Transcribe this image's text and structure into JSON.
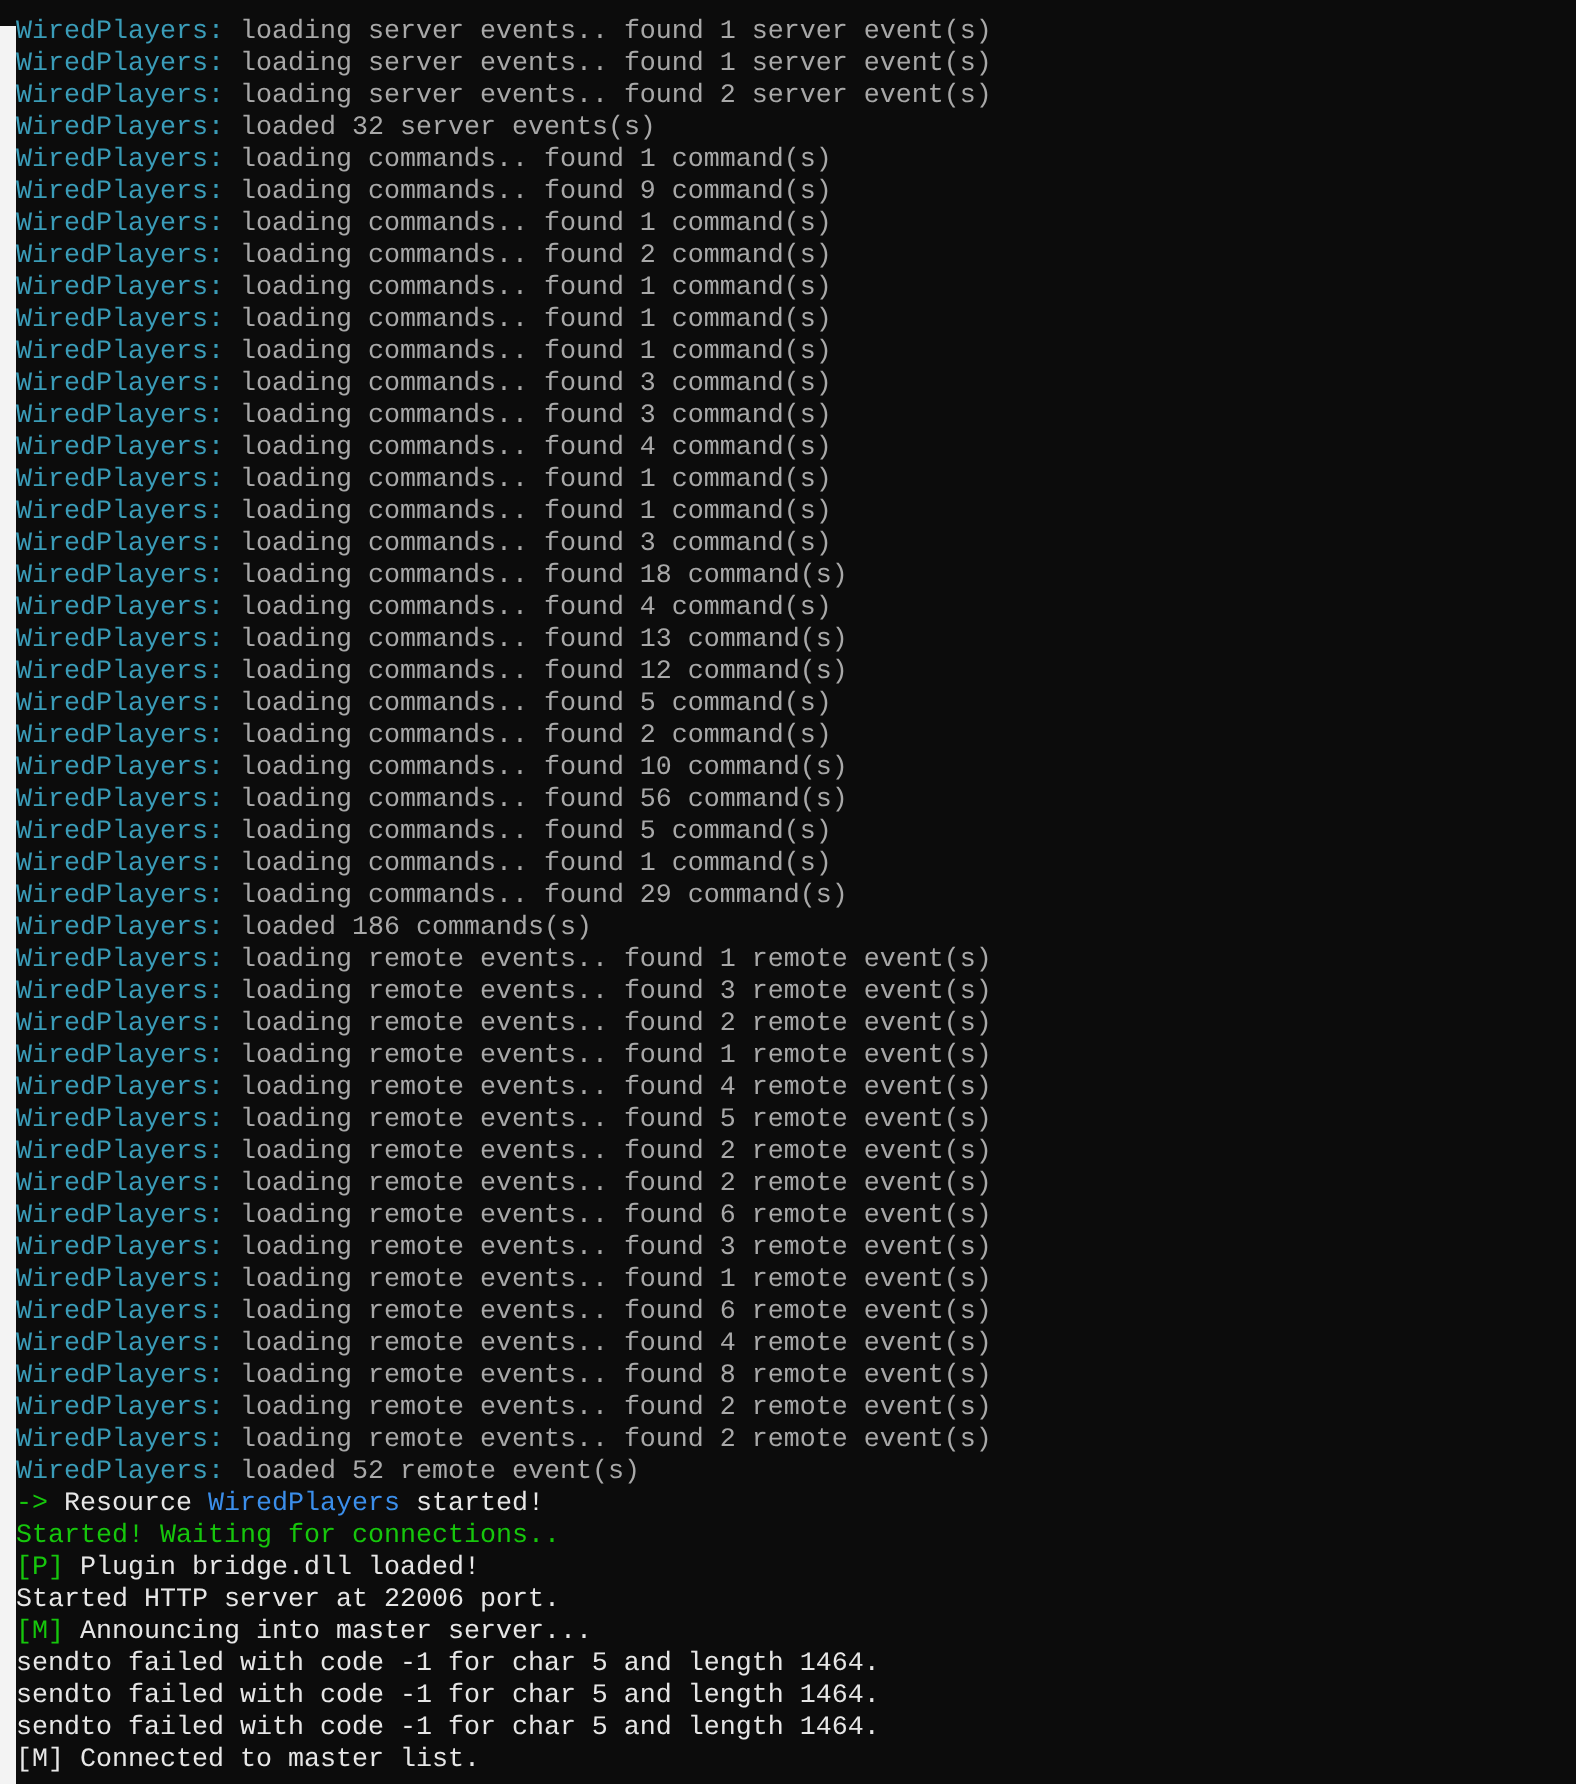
{
  "console": {
    "lines": [
      [
        {
          "text": "WiredPlayers:",
          "kind": "prefix"
        },
        {
          "text": " loading server events.. found 1 server event(s)",
          "kind": "plain"
        }
      ],
      [
        {
          "text": "WiredPlayers:",
          "kind": "prefix"
        },
        {
          "text": " loading server events.. found 1 server event(s)",
          "kind": "plain"
        }
      ],
      [
        {
          "text": "WiredPlayers:",
          "kind": "prefix"
        },
        {
          "text": " loading server events.. found 2 server event(s)",
          "kind": "plain"
        }
      ],
      [
        {
          "text": "WiredPlayers:",
          "kind": "prefix"
        },
        {
          "text": " loaded 32 server events(s)",
          "kind": "plain"
        }
      ],
      [
        {
          "text": "WiredPlayers:",
          "kind": "prefix"
        },
        {
          "text": " loading commands.. found 1 command(s)",
          "kind": "plain"
        }
      ],
      [
        {
          "text": "WiredPlayers:",
          "kind": "prefix"
        },
        {
          "text": " loading commands.. found 9 command(s)",
          "kind": "plain"
        }
      ],
      [
        {
          "text": "WiredPlayers:",
          "kind": "prefix"
        },
        {
          "text": " loading commands.. found 1 command(s)",
          "kind": "plain"
        }
      ],
      [
        {
          "text": "WiredPlayers:",
          "kind": "prefix"
        },
        {
          "text": " loading commands.. found 2 command(s)",
          "kind": "plain"
        }
      ],
      [
        {
          "text": "WiredPlayers:",
          "kind": "prefix"
        },
        {
          "text": " loading commands.. found 1 command(s)",
          "kind": "plain"
        }
      ],
      [
        {
          "text": "WiredPlayers:",
          "kind": "prefix"
        },
        {
          "text": " loading commands.. found 1 command(s)",
          "kind": "plain"
        }
      ],
      [
        {
          "text": "WiredPlayers:",
          "kind": "prefix"
        },
        {
          "text": " loading commands.. found 1 command(s)",
          "kind": "plain"
        }
      ],
      [
        {
          "text": "WiredPlayers:",
          "kind": "prefix"
        },
        {
          "text": " loading commands.. found 3 command(s)",
          "kind": "plain"
        }
      ],
      [
        {
          "text": "WiredPlayers:",
          "kind": "prefix"
        },
        {
          "text": " loading commands.. found 3 command(s)",
          "kind": "plain"
        }
      ],
      [
        {
          "text": "WiredPlayers:",
          "kind": "prefix"
        },
        {
          "text": " loading commands.. found 4 command(s)",
          "kind": "plain"
        }
      ],
      [
        {
          "text": "WiredPlayers:",
          "kind": "prefix"
        },
        {
          "text": " loading commands.. found 1 command(s)",
          "kind": "plain"
        }
      ],
      [
        {
          "text": "WiredPlayers:",
          "kind": "prefix"
        },
        {
          "text": " loading commands.. found 1 command(s)",
          "kind": "plain"
        }
      ],
      [
        {
          "text": "WiredPlayers:",
          "kind": "prefix"
        },
        {
          "text": " loading commands.. found 3 command(s)",
          "kind": "plain"
        }
      ],
      [
        {
          "text": "WiredPlayers:",
          "kind": "prefix"
        },
        {
          "text": " loading commands.. found 18 command(s)",
          "kind": "plain"
        }
      ],
      [
        {
          "text": "WiredPlayers:",
          "kind": "prefix"
        },
        {
          "text": " loading commands.. found 4 command(s)",
          "kind": "plain"
        }
      ],
      [
        {
          "text": "WiredPlayers:",
          "kind": "prefix"
        },
        {
          "text": " loading commands.. found 13 command(s)",
          "kind": "plain"
        }
      ],
      [
        {
          "text": "WiredPlayers:",
          "kind": "prefix"
        },
        {
          "text": " loading commands.. found 12 command(s)",
          "kind": "plain"
        }
      ],
      [
        {
          "text": "WiredPlayers:",
          "kind": "prefix"
        },
        {
          "text": " loading commands.. found 5 command(s)",
          "kind": "plain"
        }
      ],
      [
        {
          "text": "WiredPlayers:",
          "kind": "prefix"
        },
        {
          "text": " loading commands.. found 2 command(s)",
          "kind": "plain"
        }
      ],
      [
        {
          "text": "WiredPlayers:",
          "kind": "prefix"
        },
        {
          "text": " loading commands.. found 10 command(s)",
          "kind": "plain"
        }
      ],
      [
        {
          "text": "WiredPlayers:",
          "kind": "prefix"
        },
        {
          "text": " loading commands.. found 56 command(s)",
          "kind": "plain"
        }
      ],
      [
        {
          "text": "WiredPlayers:",
          "kind": "prefix"
        },
        {
          "text": " loading commands.. found 5 command(s)",
          "kind": "plain"
        }
      ],
      [
        {
          "text": "WiredPlayers:",
          "kind": "prefix"
        },
        {
          "text": " loading commands.. found 1 command(s)",
          "kind": "plain"
        }
      ],
      [
        {
          "text": "WiredPlayers:",
          "kind": "prefix"
        },
        {
          "text": " loading commands.. found 29 command(s)",
          "kind": "plain"
        }
      ],
      [
        {
          "text": "WiredPlayers:",
          "kind": "prefix"
        },
        {
          "text": " loaded 186 commands(s)",
          "kind": "plain"
        }
      ],
      [
        {
          "text": "WiredPlayers:",
          "kind": "prefix"
        },
        {
          "text": " loading remote events.. found 1 remote event(s)",
          "kind": "plain"
        }
      ],
      [
        {
          "text": "WiredPlayers:",
          "kind": "prefix"
        },
        {
          "text": " loading remote events.. found 3 remote event(s)",
          "kind": "plain"
        }
      ],
      [
        {
          "text": "WiredPlayers:",
          "kind": "prefix"
        },
        {
          "text": " loading remote events.. found 2 remote event(s)",
          "kind": "plain"
        }
      ],
      [
        {
          "text": "WiredPlayers:",
          "kind": "prefix"
        },
        {
          "text": " loading remote events.. found 1 remote event(s)",
          "kind": "plain"
        }
      ],
      [
        {
          "text": "WiredPlayers:",
          "kind": "prefix"
        },
        {
          "text": " loading remote events.. found 4 remote event(s)",
          "kind": "plain"
        }
      ],
      [
        {
          "text": "WiredPlayers:",
          "kind": "prefix"
        },
        {
          "text": " loading remote events.. found 5 remote event(s)",
          "kind": "plain"
        }
      ],
      [
        {
          "text": "WiredPlayers:",
          "kind": "prefix"
        },
        {
          "text": " loading remote events.. found 2 remote event(s)",
          "kind": "plain"
        }
      ],
      [
        {
          "text": "WiredPlayers:",
          "kind": "prefix"
        },
        {
          "text": " loading remote events.. found 2 remote event(s)",
          "kind": "plain"
        }
      ],
      [
        {
          "text": "WiredPlayers:",
          "kind": "prefix"
        },
        {
          "text": " loading remote events.. found 6 remote event(s)",
          "kind": "plain"
        }
      ],
      [
        {
          "text": "WiredPlayers:",
          "kind": "prefix"
        },
        {
          "text": " loading remote events.. found 3 remote event(s)",
          "kind": "plain"
        }
      ],
      [
        {
          "text": "WiredPlayers:",
          "kind": "prefix"
        },
        {
          "text": " loading remote events.. found 1 remote event(s)",
          "kind": "plain"
        }
      ],
      [
        {
          "text": "WiredPlayers:",
          "kind": "prefix"
        },
        {
          "text": " loading remote events.. found 6 remote event(s)",
          "kind": "plain"
        }
      ],
      [
        {
          "text": "WiredPlayers:",
          "kind": "prefix"
        },
        {
          "text": " loading remote events.. found 4 remote event(s)",
          "kind": "plain"
        }
      ],
      [
        {
          "text": "WiredPlayers:",
          "kind": "prefix"
        },
        {
          "text": " loading remote events.. found 8 remote event(s)",
          "kind": "plain"
        }
      ],
      [
        {
          "text": "WiredPlayers:",
          "kind": "prefix"
        },
        {
          "text": " loading remote events.. found 2 remote event(s)",
          "kind": "plain"
        }
      ],
      [
        {
          "text": "WiredPlayers:",
          "kind": "prefix"
        },
        {
          "text": " loading remote events.. found 2 remote event(s)",
          "kind": "plain"
        }
      ],
      [
        {
          "text": "WiredPlayers:",
          "kind": "prefix"
        },
        {
          "text": " loaded 52 remote event(s)",
          "kind": "plain"
        }
      ],
      [
        {
          "text": "->",
          "kind": "green"
        },
        {
          "text": " Resource ",
          "kind": "white"
        },
        {
          "text": "WiredPlayers",
          "kind": "accent"
        },
        {
          "text": " started!",
          "kind": "white"
        }
      ],
      [
        {
          "text": "Started! Waiting for connections..",
          "kind": "green"
        }
      ],
      [
        {
          "text": "[P]",
          "kind": "green"
        },
        {
          "text": " Plugin bridge.dll loaded!",
          "kind": "white"
        }
      ],
      [
        {
          "text": "Started HTTP server at 22006 port.",
          "kind": "white"
        }
      ],
      [
        {
          "text": "[M]",
          "kind": "green"
        },
        {
          "text": " Announcing into master server...",
          "kind": "white"
        }
      ],
      [
        {
          "text": "sendto failed with code -1 for char 5 and length 1464.",
          "kind": "white"
        }
      ],
      [
        {
          "text": "sendto failed with code -1 for char 5 and length 1464.",
          "kind": "white"
        }
      ],
      [
        {
          "text": "sendto failed with code -1 for char 5 and length 1464.",
          "kind": "white"
        }
      ],
      [
        {
          "text": "[M] Connected to master list.",
          "kind": "white"
        }
      ]
    ]
  }
}
